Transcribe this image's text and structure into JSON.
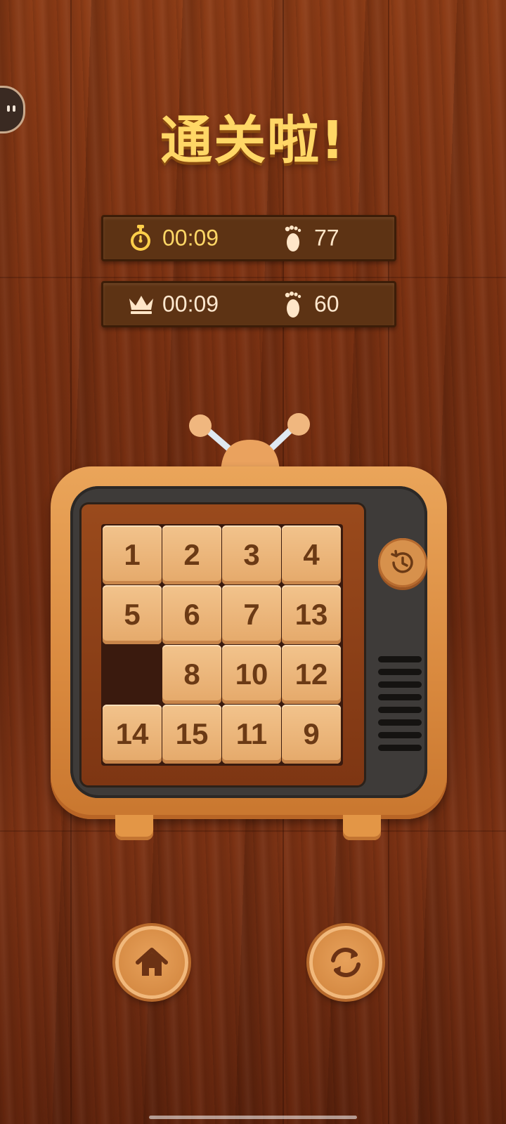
{
  "title": "通关啦!",
  "current_result": {
    "time": "00:09",
    "steps": "77"
  },
  "best_result": {
    "time": "00:09",
    "steps": "60"
  },
  "icons": {
    "timer": "stopwatch-icon",
    "steps": "footprint-icon",
    "best": "crown-icon",
    "history": "history-icon",
    "home": "home-icon",
    "restart": "refresh-icon",
    "side": "chat-bubble-icon"
  },
  "board": {
    "rows": [
      [
        "1",
        "2",
        "3",
        "4"
      ],
      [
        "5",
        "6",
        "7",
        "13"
      ],
      [
        "",
        "8",
        "10",
        "12"
      ],
      [
        "14",
        "15",
        "11",
        "9"
      ]
    ]
  },
  "colors": {
    "title": "#ffd766",
    "tile": "#e5a96a",
    "tile_text": "#6b3a15",
    "tv_body": "#d9893e",
    "tv_inner": "#3e3b39"
  }
}
